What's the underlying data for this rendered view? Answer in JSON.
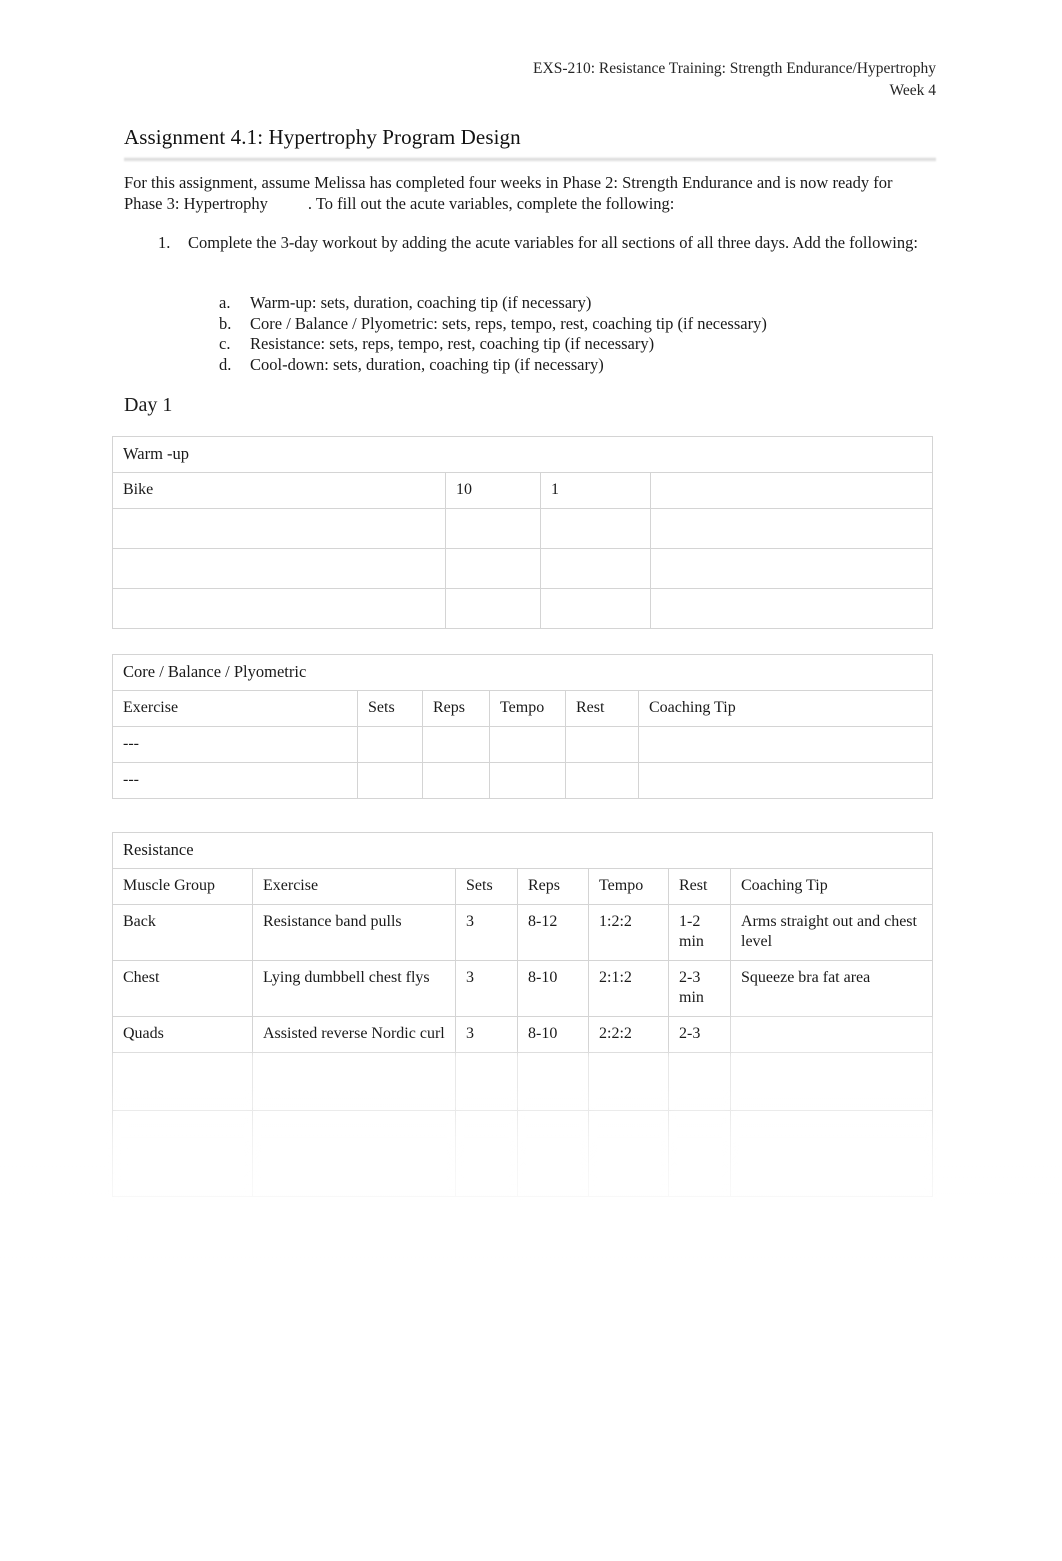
{
  "header": {
    "course": "EXS-210: Resistance Training: Strength Endurance/Hypertrophy",
    "week": "Week 4"
  },
  "title": "Assignment 4.1: Hypertrophy Program Design",
  "intro": {
    "part1": "For this assignment, assume Melissa has completed four weeks in Phase 2: Strength Endurance and is now ready for",
    "phase": "Phase 3: Hypertrophy",
    "part2": ". To fill out the acute variables, complete the following:"
  },
  "instructions": {
    "number": "1.",
    "text": "Complete the 3-day workout by adding the acute variables for all sections of all three days. Add the following:",
    "sub_items": [
      {
        "marker": "a.",
        "text": "Warm-up: sets, duration, coaching tip (if necessary)"
      },
      {
        "marker": "b.",
        "text": "Core / Balance / Plyometric: sets, reps, tempo, rest, coaching tip (if necessary)"
      },
      {
        "marker": "c.",
        "text": "Resistance: sets, reps, tempo, rest, coaching tip (if necessary)"
      },
      {
        "marker": "d.",
        "text": "Cool-down: sets, duration, coaching tip (if necessary)"
      }
    ]
  },
  "day_heading": "Day 1",
  "warmup": {
    "section_title": "Warm -up",
    "rows": [
      {
        "exercise": "Bike",
        "duration": "10",
        "sets": "1",
        "tip": ""
      },
      {
        "exercise": "",
        "duration": "",
        "sets": "",
        "tip": ""
      },
      {
        "exercise": "",
        "duration": "",
        "sets": "",
        "tip": ""
      },
      {
        "exercise": "",
        "duration": "",
        "sets": "",
        "tip": ""
      }
    ]
  },
  "core": {
    "section_title": "Core / Balance / Plyometric",
    "headers": [
      "Exercise",
      "Sets",
      "Reps",
      "Tempo",
      "Rest",
      "Coaching Tip"
    ],
    "rows": [
      {
        "exercise": "---",
        "sets": "",
        "reps": "",
        "tempo": "",
        "rest": "",
        "tip": ""
      },
      {
        "exercise": "---",
        "sets": "",
        "reps": "",
        "tempo": "",
        "rest": "",
        "tip": ""
      }
    ]
  },
  "resistance": {
    "section_title": "Resistance",
    "headers": [
      "Muscle Group",
      "Exercise",
      "Sets",
      "Reps",
      "Tempo",
      "Rest",
      "Coaching Tip"
    ],
    "rows": [
      {
        "muscle_group": "Back",
        "exercise": "Resistance band pulls",
        "sets": "3",
        "reps": "8-12",
        "tempo": "1:2:2",
        "rest": "1-2 min",
        "tip": "Arms straight out and chest level"
      },
      {
        "muscle_group": "Chest",
        "exercise": "Lying dumbbell chest flys",
        "sets": "3",
        "reps": "8-10",
        "tempo": "2:1:2",
        "rest": "2-3 min",
        "tip": "Squeeze bra fat area"
      },
      {
        "muscle_group": "Quads",
        "exercise": "Assisted reverse Nordic curl",
        "sets": "3",
        "reps": "8-10",
        "tempo": "2:2:2",
        "rest": "2-3",
        "tip": ""
      },
      {
        "muscle_group": "",
        "exercise": "",
        "sets": "",
        "reps": "",
        "tempo": "",
        "rest": "",
        "tip": ""
      },
      {
        "muscle_group": "",
        "exercise": "",
        "sets": "",
        "reps": "",
        "tempo": "",
        "rest": "",
        "tip": ""
      }
    ]
  }
}
